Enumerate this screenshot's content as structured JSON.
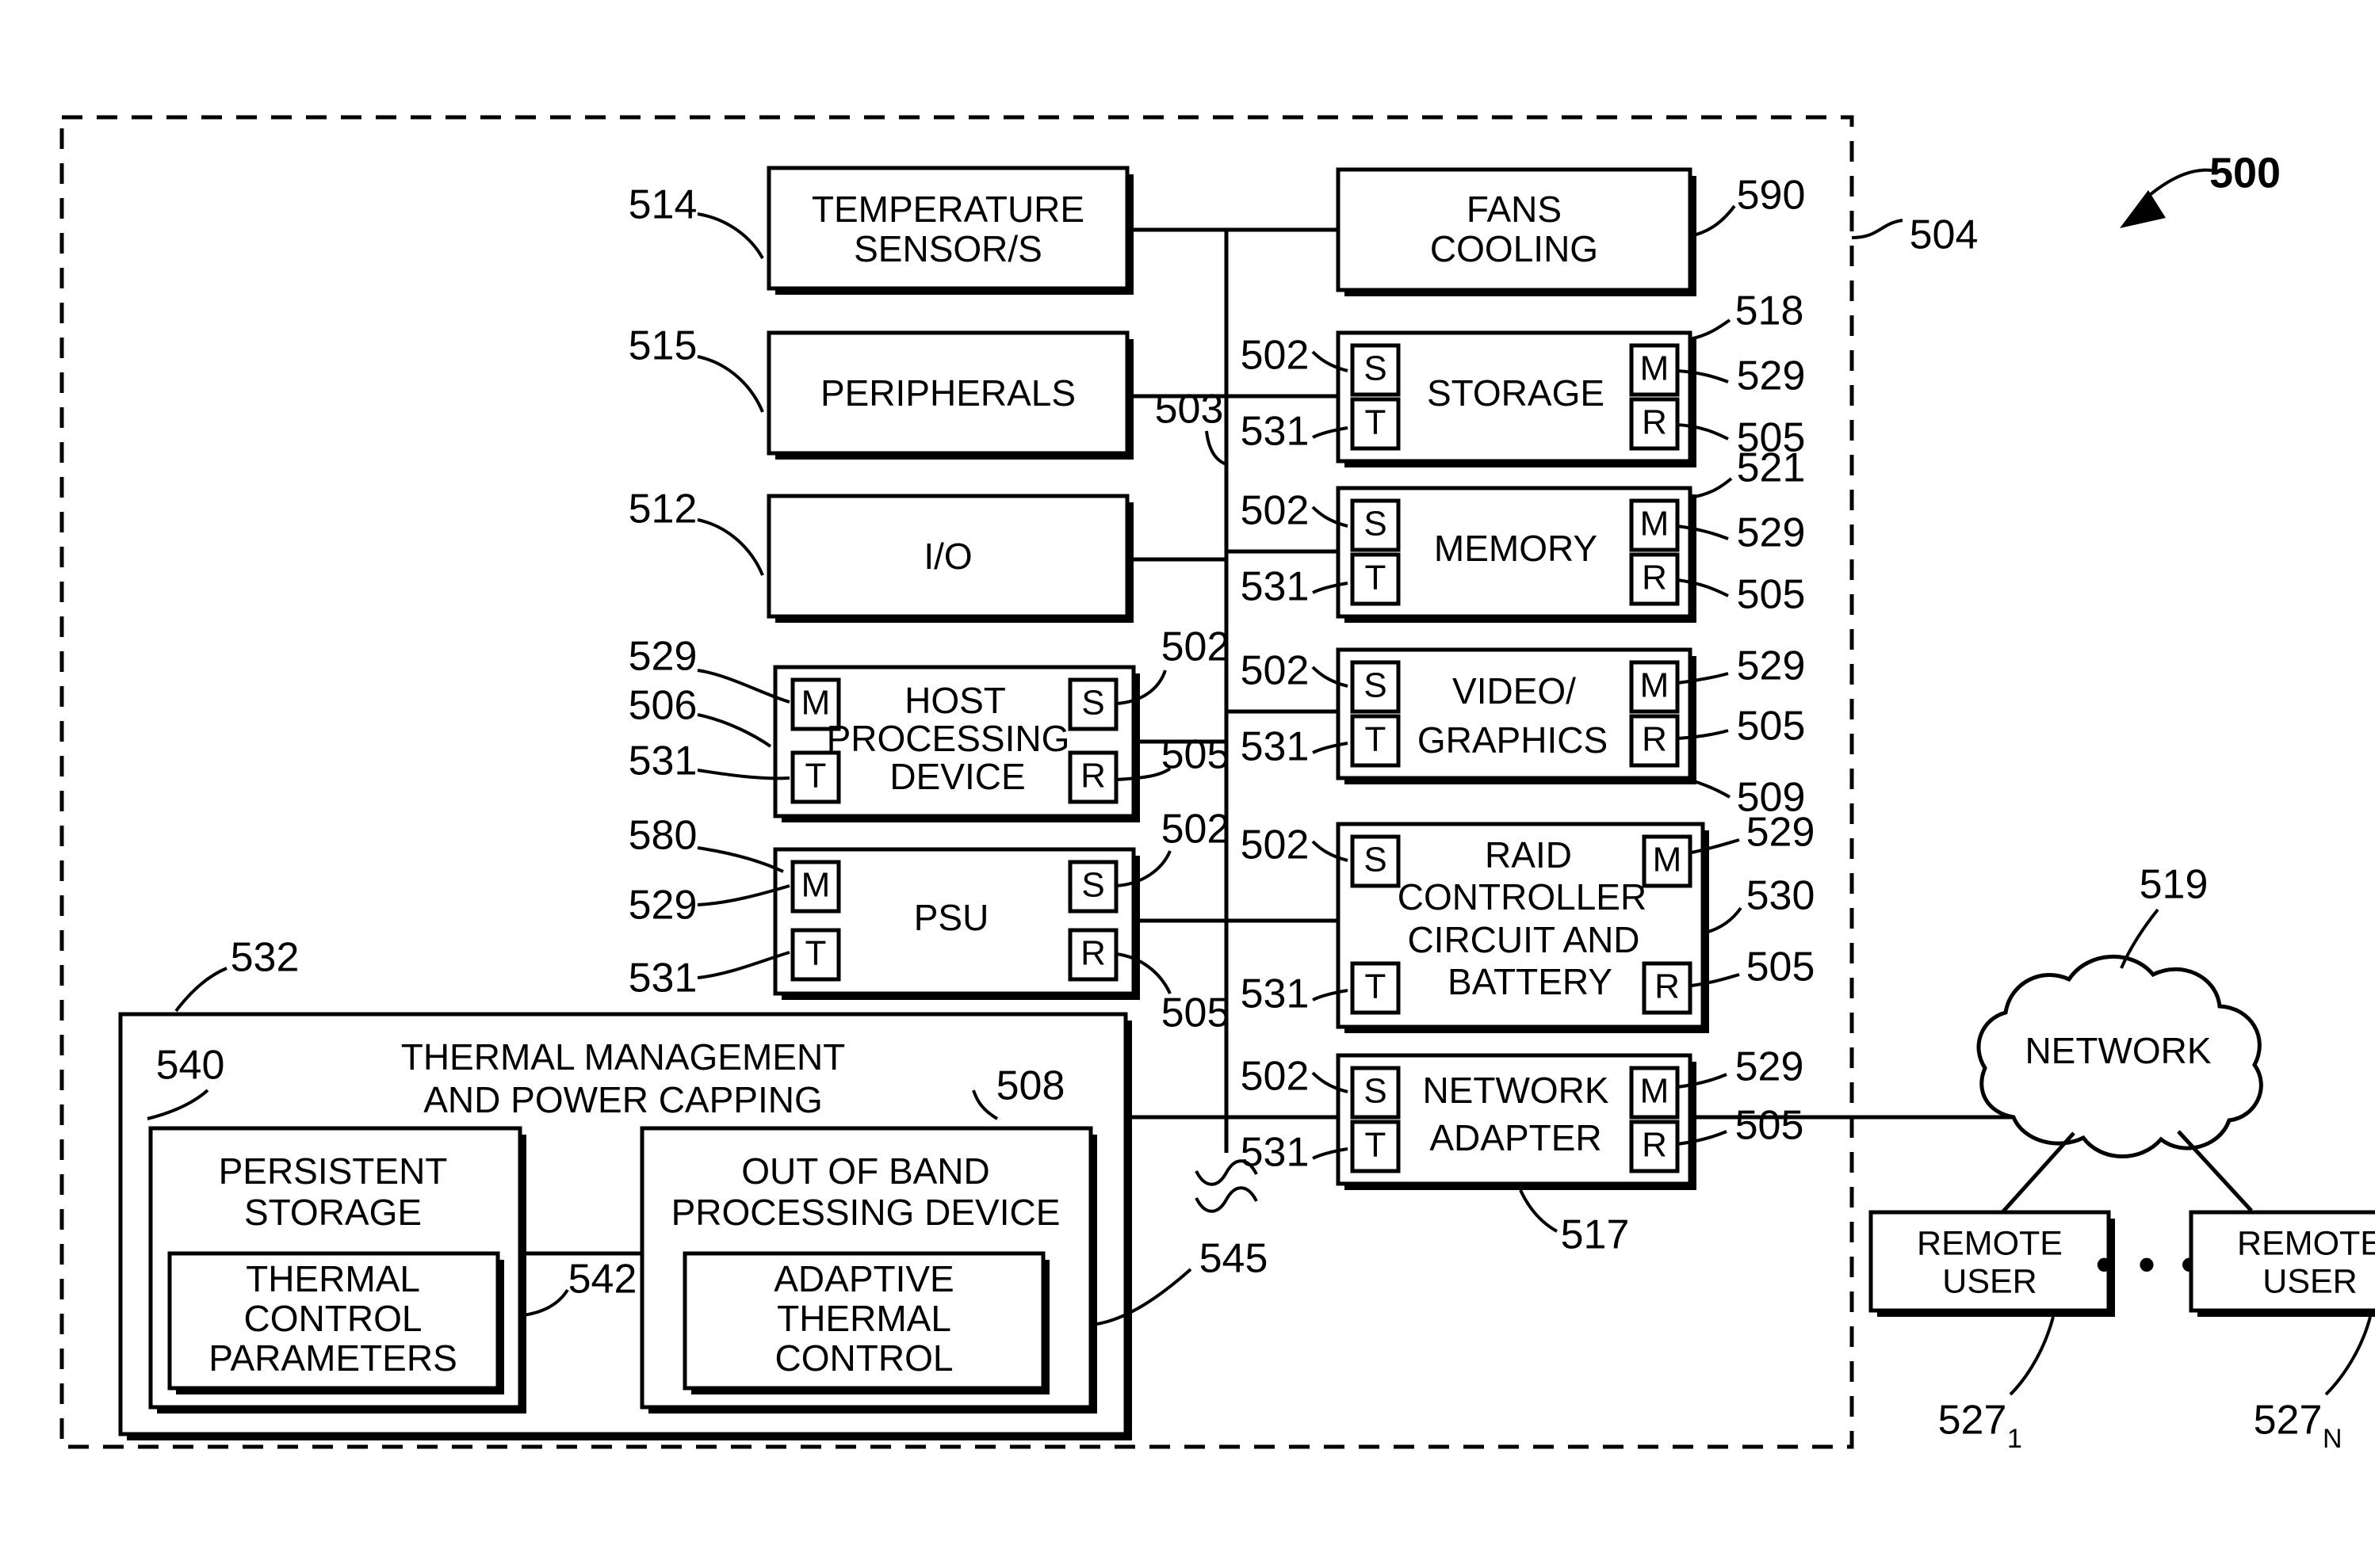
{
  "figure": {
    "number": "500",
    "chassis_ref": "504",
    "bus_ref": "503"
  },
  "left_column": [
    {
      "id": "temperature-sensors",
      "lines": [
        "TEMPERATURE",
        "SENSOR/S"
      ],
      "ref_left": "514"
    },
    {
      "id": "peripherals",
      "lines": [
        "PERIPHERALS"
      ],
      "ref_left": "515"
    },
    {
      "id": "io",
      "lines": [
        "I/O"
      ],
      "ref_left": "512"
    },
    {
      "id": "host-processing-device",
      "lines": [
        "HOST",
        "PROCESSING",
        "DEVICE"
      ],
      "ref_left": "506",
      "refs_left_extra": [
        "529",
        "531"
      ],
      "refs_right": [
        "502",
        "505"
      ],
      "badges": {
        "tl": "M",
        "bl": "T",
        "tr": "S",
        "br": "R"
      }
    },
    {
      "id": "psu",
      "lines": [
        "PSU"
      ],
      "ref_left": "580",
      "refs_left_extra": [
        "529",
        "531"
      ],
      "refs_right": [
        "502",
        "505"
      ],
      "badges": {
        "tl": "M",
        "bl": "T",
        "tr": "S",
        "br": "R"
      }
    }
  ],
  "right_column": [
    {
      "id": "fans-cooling",
      "lines": [
        "FANS",
        "COOLING"
      ],
      "refs_right": [
        "590"
      ],
      "badges": null
    },
    {
      "id": "storage",
      "lines": [
        "STORAGE"
      ],
      "refs_left": [
        "502",
        "531"
      ],
      "refs_right": [
        "518",
        "529",
        "505"
      ],
      "badges": {
        "tl": "S",
        "bl": "T",
        "tr": "M",
        "br": "R"
      }
    },
    {
      "id": "memory",
      "lines": [
        "MEMORY"
      ],
      "refs_left": [
        "502",
        "531"
      ],
      "refs_right": [
        "521",
        "529",
        "505"
      ],
      "badges": {
        "tl": "S",
        "bl": "T",
        "tr": "M",
        "br": "R"
      }
    },
    {
      "id": "video-graphics",
      "lines": [
        "VIDEO/",
        "GRAPHICS"
      ],
      "refs_left": [
        "502",
        "531"
      ],
      "refs_right": [
        "529",
        "505",
        "509"
      ],
      "badges": {
        "tl": "S",
        "bl": "T",
        "tr": "M",
        "br": "R"
      }
    },
    {
      "id": "raid-controller",
      "lines": [
        "RAID",
        "CONTROLLER",
        "CIRCUIT AND",
        "BATTERY"
      ],
      "refs_left": [
        "502",
        "531"
      ],
      "refs_right": [
        "529",
        "530",
        "505"
      ],
      "badges": {
        "tl": "S",
        "bl": "T",
        "tr": "M",
        "br": "R"
      }
    },
    {
      "id": "network-adapter",
      "lines": [
        "NETWORK",
        "ADAPTER"
      ],
      "refs_left": [
        "502",
        "531"
      ],
      "refs_right": [
        "529",
        "505"
      ],
      "ref_below": "517",
      "badges": {
        "tl": "S",
        "bl": "T",
        "tr": "M",
        "br": "R"
      }
    }
  ],
  "thermal_panel": {
    "ref": "532",
    "title_line1": "THERMAL MANAGEMENT",
    "title_line2": "AND POWER CAPPING",
    "persistent_storage": {
      "ref": "540",
      "lines": [
        "PERSISTENT",
        "STORAGE"
      ],
      "inner": {
        "lines": [
          "THERMAL",
          "CONTROL",
          "PARAMETERS"
        ]
      }
    },
    "link_ref": "542",
    "oob_processing": {
      "ref": "508",
      "lines": [
        "OUT OF BAND",
        "PROCESSING DEVICE"
      ],
      "inner": {
        "ref": "545",
        "lines": [
          "ADAPTIVE",
          "THERMAL",
          "CONTROL"
        ]
      }
    }
  },
  "network_side": {
    "cloud_label": "NETWORK",
    "cloud_ref": "519",
    "ellipsis": "• • •",
    "remote_users": [
      {
        "lines": [
          "REMOTE",
          "USER"
        ],
        "ref_base": "527",
        "ref_sub": "1"
      },
      {
        "lines": [
          "REMOTE",
          "USER"
        ],
        "ref_base": "527",
        "ref_sub": "N"
      }
    ]
  },
  "colors": {
    "ink": "#000000",
    "paper": "#ffffff"
  }
}
